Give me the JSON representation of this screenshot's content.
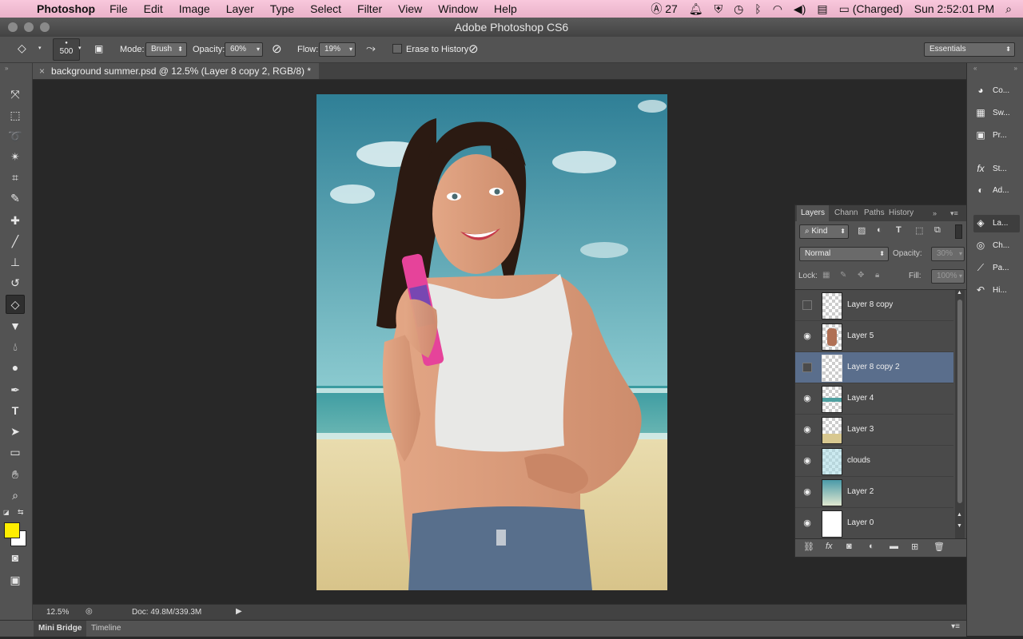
{
  "menubar": {
    "app_name": "Photoshop",
    "items": [
      "File",
      "Edit",
      "Image",
      "Layer",
      "Type",
      "Select",
      "Filter",
      "View",
      "Window",
      "Help"
    ],
    "status": {
      "adobe_count": "27",
      "battery": "(Charged)",
      "clock": "Sun 2:52:01 PM"
    }
  },
  "window": {
    "title": "Adobe Photoshop CS6"
  },
  "options": {
    "brush_size": "500",
    "mode_label": "Mode:",
    "mode_value": "Brush",
    "opacity_label": "Opacity:",
    "opacity_value": "60%",
    "flow_label": "Flow:",
    "flow_value": "19%",
    "erase_history_label": "Erase to History",
    "workspace": "Essentials"
  },
  "document": {
    "tab_title": "background summer.psd @ 12.5% (Layer 8 copy 2, RGB/8) *",
    "zoom": "12.5%",
    "doc_size": "Doc: 49.8M/339.3M"
  },
  "bottom": {
    "tabs": [
      "Mini Bridge",
      "Timeline"
    ]
  },
  "dock": {
    "items": [
      {
        "label": "Co...",
        "icon": "color-palette-icon"
      },
      {
        "label": "Sw...",
        "icon": "swatches-icon"
      },
      {
        "label": "Pr...",
        "icon": "presets-icon"
      },
      {
        "label": "St...",
        "icon": "styles-fx-icon"
      },
      {
        "label": "Ad...",
        "icon": "adjustments-icon"
      },
      {
        "label": "La...",
        "icon": "layers-icon"
      },
      {
        "label": "Ch...",
        "icon": "channels-icon"
      },
      {
        "label": "Pa...",
        "icon": "paths-icon"
      },
      {
        "label": "Hi...",
        "icon": "history-icon"
      }
    ]
  },
  "layers_panel": {
    "tabs": [
      "Layers",
      "Chann",
      "Paths",
      "History"
    ],
    "filter_kind": "Kind",
    "blend_mode": "Normal",
    "opacity_label": "Opacity:",
    "opacity_value": "30%",
    "lock_label": "Lock:",
    "fill_label": "Fill:",
    "fill_value": "100%",
    "layers": [
      {
        "name": "Layer 8 copy",
        "visible": false,
        "selected": false,
        "thumb": "checker"
      },
      {
        "name": "Layer 5",
        "visible": true,
        "selected": false,
        "thumb": "portrait"
      },
      {
        "name": "Layer 8 copy 2",
        "visible": false,
        "selected": true,
        "thumb": "checker"
      },
      {
        "name": "Layer 4",
        "visible": true,
        "selected": false,
        "thumb": "waves"
      },
      {
        "name": "Layer 3",
        "visible": true,
        "selected": false,
        "thumb": "sand"
      },
      {
        "name": "clouds",
        "visible": true,
        "selected": false,
        "thumb": "clouds"
      },
      {
        "name": "Layer 2",
        "visible": true,
        "selected": false,
        "thumb": "gradient"
      },
      {
        "name": "Layer 0",
        "visible": true,
        "selected": false,
        "thumb": "white"
      }
    ]
  },
  "colors": {
    "foreground": "#ffee00",
    "background": "#ffffff",
    "selection": "#5a6e8c"
  }
}
